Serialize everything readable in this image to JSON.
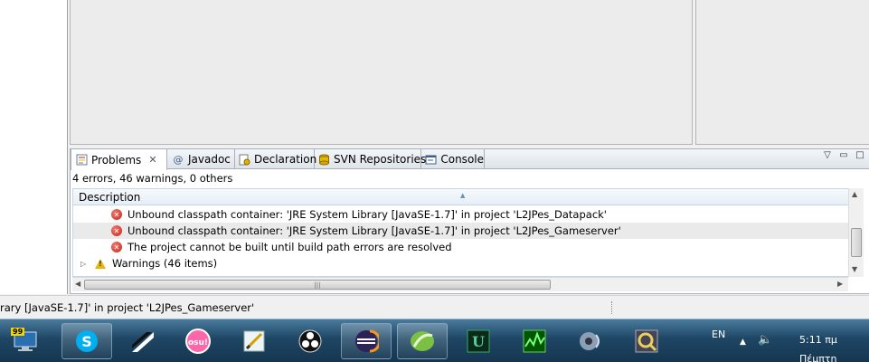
{
  "tabs": [
    {
      "label": "Problems",
      "icon": "problems-icon",
      "active": true
    },
    {
      "label": "Javadoc",
      "icon": "at-icon",
      "active": false
    },
    {
      "label": "Declaration",
      "icon": "declaration-icon",
      "active": false
    },
    {
      "label": "SVN Repositories",
      "icon": "svn-icon",
      "active": false
    },
    {
      "label": "Console",
      "icon": "console-icon",
      "active": false
    }
  ],
  "problems": {
    "summary": "4 errors, 46 warnings, 0 others",
    "column": "Description",
    "rows": [
      "Unbound classpath container: 'JRE System Library [JavaSE-1.7]' in project 'L2JPes_Datapack'",
      "Unbound classpath container: 'JRE System Library [JavaSE-1.7]' in project 'L2JPes_Gameserver'",
      "The project cannot be built until build path errors are resolved"
    ],
    "warnings_group": "Warnings (46 items)"
  },
  "status": {
    "text": "rary [JavaSE-1.7]' in project 'L2JPes_Gameserver'"
  },
  "taskbar": {
    "start_badge": "99",
    "apps": [
      "computer",
      "skype",
      "stripes",
      "osu",
      "pen-tool",
      "obs",
      "eclipse",
      "green-leaf",
      "unreal",
      "spectrum",
      "audio",
      "q-app"
    ],
    "osu_label": "osu!",
    "lang": "EN",
    "time": "5:11 πμ",
    "day": "Πέμπτη"
  },
  "colors": {
    "error": "#c8231a",
    "warning": "#e7b416",
    "taskbar": "#1e4664",
    "header": "#e6eef7"
  }
}
